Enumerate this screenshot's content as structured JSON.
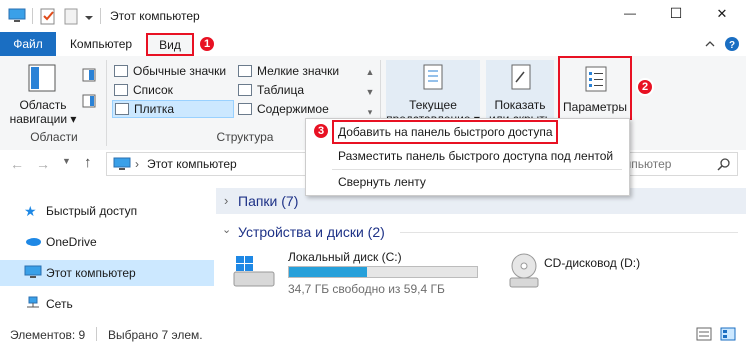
{
  "title": "Этот компьютер",
  "window_controls": {
    "minimize": "—",
    "maximize": "☐",
    "close": "✕"
  },
  "ribbon_tabs": {
    "file": "Файл",
    "computer": "Компьютер",
    "view": "Вид"
  },
  "badges": {
    "b1": "1",
    "b2": "2",
    "b3": "3"
  },
  "ribbon": {
    "areas": {
      "nav_pane_line1": "Область",
      "nav_pane_line2": "навигации ▾",
      "group_label": "Области"
    },
    "layout": {
      "items": [
        "Обычные значки",
        "Мелкие значки",
        "Список",
        "Таблица",
        "Плитка",
        "Содержимое"
      ],
      "group_label": "Структура"
    },
    "current_view_line1": "Текущее",
    "current_view_line2": "представление ▾",
    "show_hide_line1": "Показать",
    "show_hide_line2": "или скрыть ▾",
    "options": "Параметры"
  },
  "context_menu": {
    "items": [
      "Добавить на панель быстрого доступа",
      "Разместить панель быстрого доступа под лентой",
      "Свернуть ленту"
    ]
  },
  "address": {
    "path": "Этот компьютер",
    "search_placeholder": "мпьютер"
  },
  "nav": {
    "items": [
      {
        "label": "Быстрый доступ",
        "icon": "star-icon",
        "color": "#1e88e5"
      },
      {
        "label": "OneDrive",
        "icon": "cloud-icon",
        "color": "#1e88e5"
      },
      {
        "label": "Этот компьютер",
        "icon": "computer-icon",
        "color": "#1e88e5"
      },
      {
        "label": "Сеть",
        "icon": "network-icon",
        "color": "#1e88e5"
      }
    ]
  },
  "content": {
    "folders_header": "Папки (7)",
    "devices_header": "Устройства и диски (2)",
    "local_disk": {
      "name": "Локальный диск (C:)",
      "free": "34,7 ГБ свободно из 59,4 ГБ",
      "used_fraction": 0.416
    },
    "cd_drive": {
      "name": "CD-дисковод (D:)"
    }
  },
  "status": {
    "items_count": "Элементов: 9",
    "selected": "Выбрано 7 элем."
  },
  "colors": {
    "accent": "#1a6ec2",
    "highlight": "#e81123",
    "selection": "#cce8ff",
    "progress": "#26a0da"
  }
}
